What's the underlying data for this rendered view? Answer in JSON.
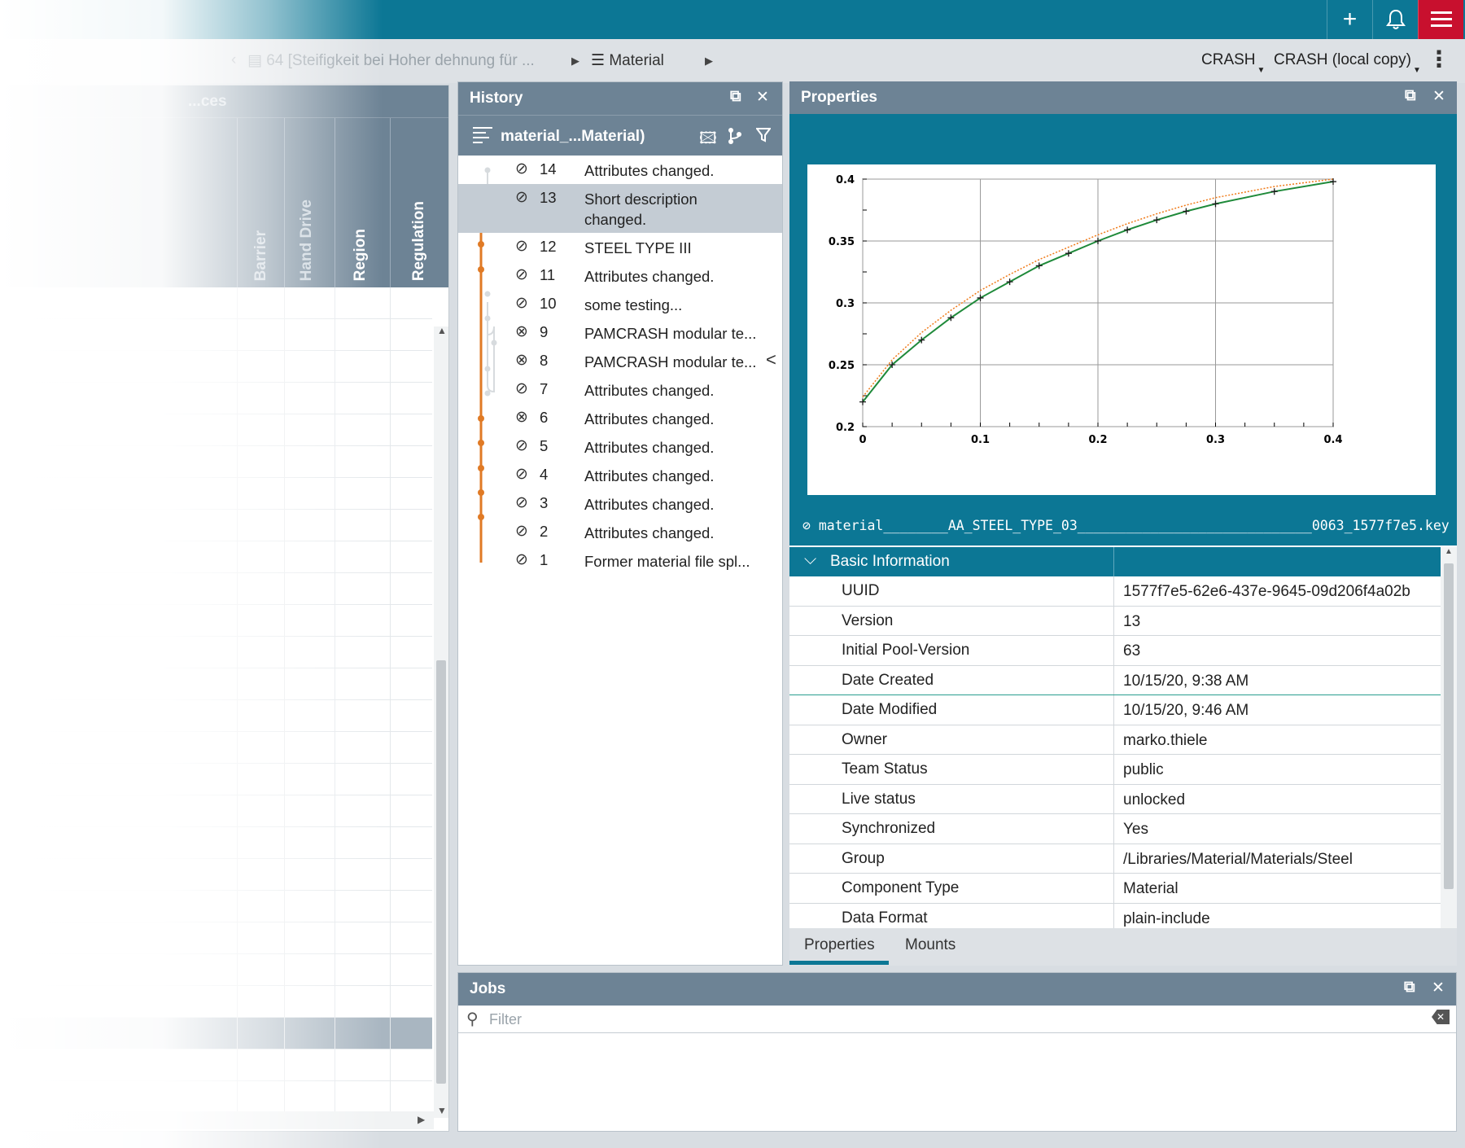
{
  "topbar": {
    "add_icon": "plus-icon",
    "bell_icon": "bell-icon",
    "menu_icon": "hamburger-icon",
    "add_glyph": "+",
    "bell_glyph": "🔔",
    "menu_glyph": "≡"
  },
  "breadcrumb": {
    "item1": "64 [Steifigkeit bei Hoher dehnung für ...",
    "item2": "Material",
    "select1": "CRASH",
    "select2": "CRASH (local copy)",
    "kebab": "⋮"
  },
  "left_table": {
    "columns": [
      "Barrier",
      "Hand Drive",
      "Region",
      "Regulation"
    ],
    "header_title": "...ces"
  },
  "history": {
    "title": "History",
    "subtitle": "material_...Material)",
    "collapse_glyph": "<",
    "entries": [
      {
        "num": "14",
        "status": "ok",
        "msg": "Attributes changed."
      },
      {
        "num": "13",
        "status": "ok",
        "msg": "Short description changed."
      },
      {
        "num": "12",
        "status": "ok",
        "msg": "STEEL TYPE III"
      },
      {
        "num": "11",
        "status": "ok",
        "msg": "Attributes changed."
      },
      {
        "num": "10",
        "status": "ok",
        "msg": "some testing..."
      },
      {
        "num": "9",
        "status": "error",
        "msg": "PAMCRASH modular te..."
      },
      {
        "num": "8",
        "status": "error",
        "msg": "PAMCRASH modular te..."
      },
      {
        "num": "7",
        "status": "ok",
        "msg": "Attributes changed."
      },
      {
        "num": "6",
        "status": "error",
        "msg": "Attributes changed."
      },
      {
        "num": "5",
        "status": "ok",
        "msg": "Attributes changed."
      },
      {
        "num": "4",
        "status": "ok",
        "msg": "Attributes changed."
      },
      {
        "num": "3",
        "status": "ok",
        "msg": "Attributes changed."
      },
      {
        "num": "2",
        "status": "ok",
        "msg": "Attributes changed."
      },
      {
        "num": "1",
        "status": "ok",
        "msg": "Former material file spl..."
      }
    ]
  },
  "properties": {
    "title": "Properties",
    "file_name": "material________AA_STEEL_TYPE_03_____________________________0063_1577f7e5.key",
    "section": "Basic Information",
    "rows": [
      {
        "key": "UUID",
        "value": "1577f7e5-62e6-437e-9645-09d206f4a02b"
      },
      {
        "key": "Version",
        "value": "13"
      },
      {
        "key": "Initial Pool-Version",
        "value": "63"
      },
      {
        "key": "Date Created",
        "value": "10/15/20, 9:38 AM"
      },
      {
        "key": "Date Modified",
        "value": "10/15/20, 9:46 AM"
      },
      {
        "key": "Owner",
        "value": "marko.thiele"
      },
      {
        "key": "Team Status",
        "value": "public"
      },
      {
        "key": "Live status",
        "value": "unlocked"
      },
      {
        "key": "Synchronized",
        "value": "Yes"
      },
      {
        "key": "Group",
        "value": "/Libraries/Material/Materials/Steel"
      },
      {
        "key": "Component Type",
        "value": "Material"
      },
      {
        "key": "Data Format",
        "value": "plain-include"
      }
    ],
    "tabs": [
      "Properties",
      "Mounts"
    ]
  },
  "jobs": {
    "title": "Jobs",
    "filter_placeholder": "Filter"
  },
  "chart_data": {
    "type": "line",
    "xlim": [
      0,
      0.4
    ],
    "ylim": [
      0.2,
      0.4
    ],
    "x_ticks": [
      "0",
      "0.1",
      "0.2",
      "0.3",
      "0.4"
    ],
    "y_ticks": [
      "0.2",
      "0.25",
      "0.3",
      "0.35",
      "0.4"
    ],
    "grid": true,
    "series": [
      {
        "color": "#1f8a3a",
        "marker": "plus",
        "x": [
          0,
          0.025,
          0.05,
          0.075,
          0.1,
          0.125,
          0.15,
          0.175,
          0.2,
          0.225,
          0.25,
          0.275,
          0.3,
          0.35,
          0.4
        ],
        "y": [
          0.22,
          0.25,
          0.27,
          0.288,
          0.304,
          0.317,
          0.33,
          0.34,
          0.35,
          0.359,
          0.367,
          0.374,
          0.38,
          0.39,
          0.398
        ]
      },
      {
        "color": "#f07b1a",
        "style": "dotted",
        "x": [
          0,
          0.025,
          0.05,
          0.075,
          0.1,
          0.125,
          0.15,
          0.175,
          0.2,
          0.225,
          0.25,
          0.275,
          0.3,
          0.35,
          0.4
        ],
        "y": [
          0.224,
          0.254,
          0.276,
          0.294,
          0.31,
          0.323,
          0.335,
          0.345,
          0.355,
          0.364,
          0.372,
          0.379,
          0.385,
          0.394,
          0.4
        ]
      }
    ]
  }
}
